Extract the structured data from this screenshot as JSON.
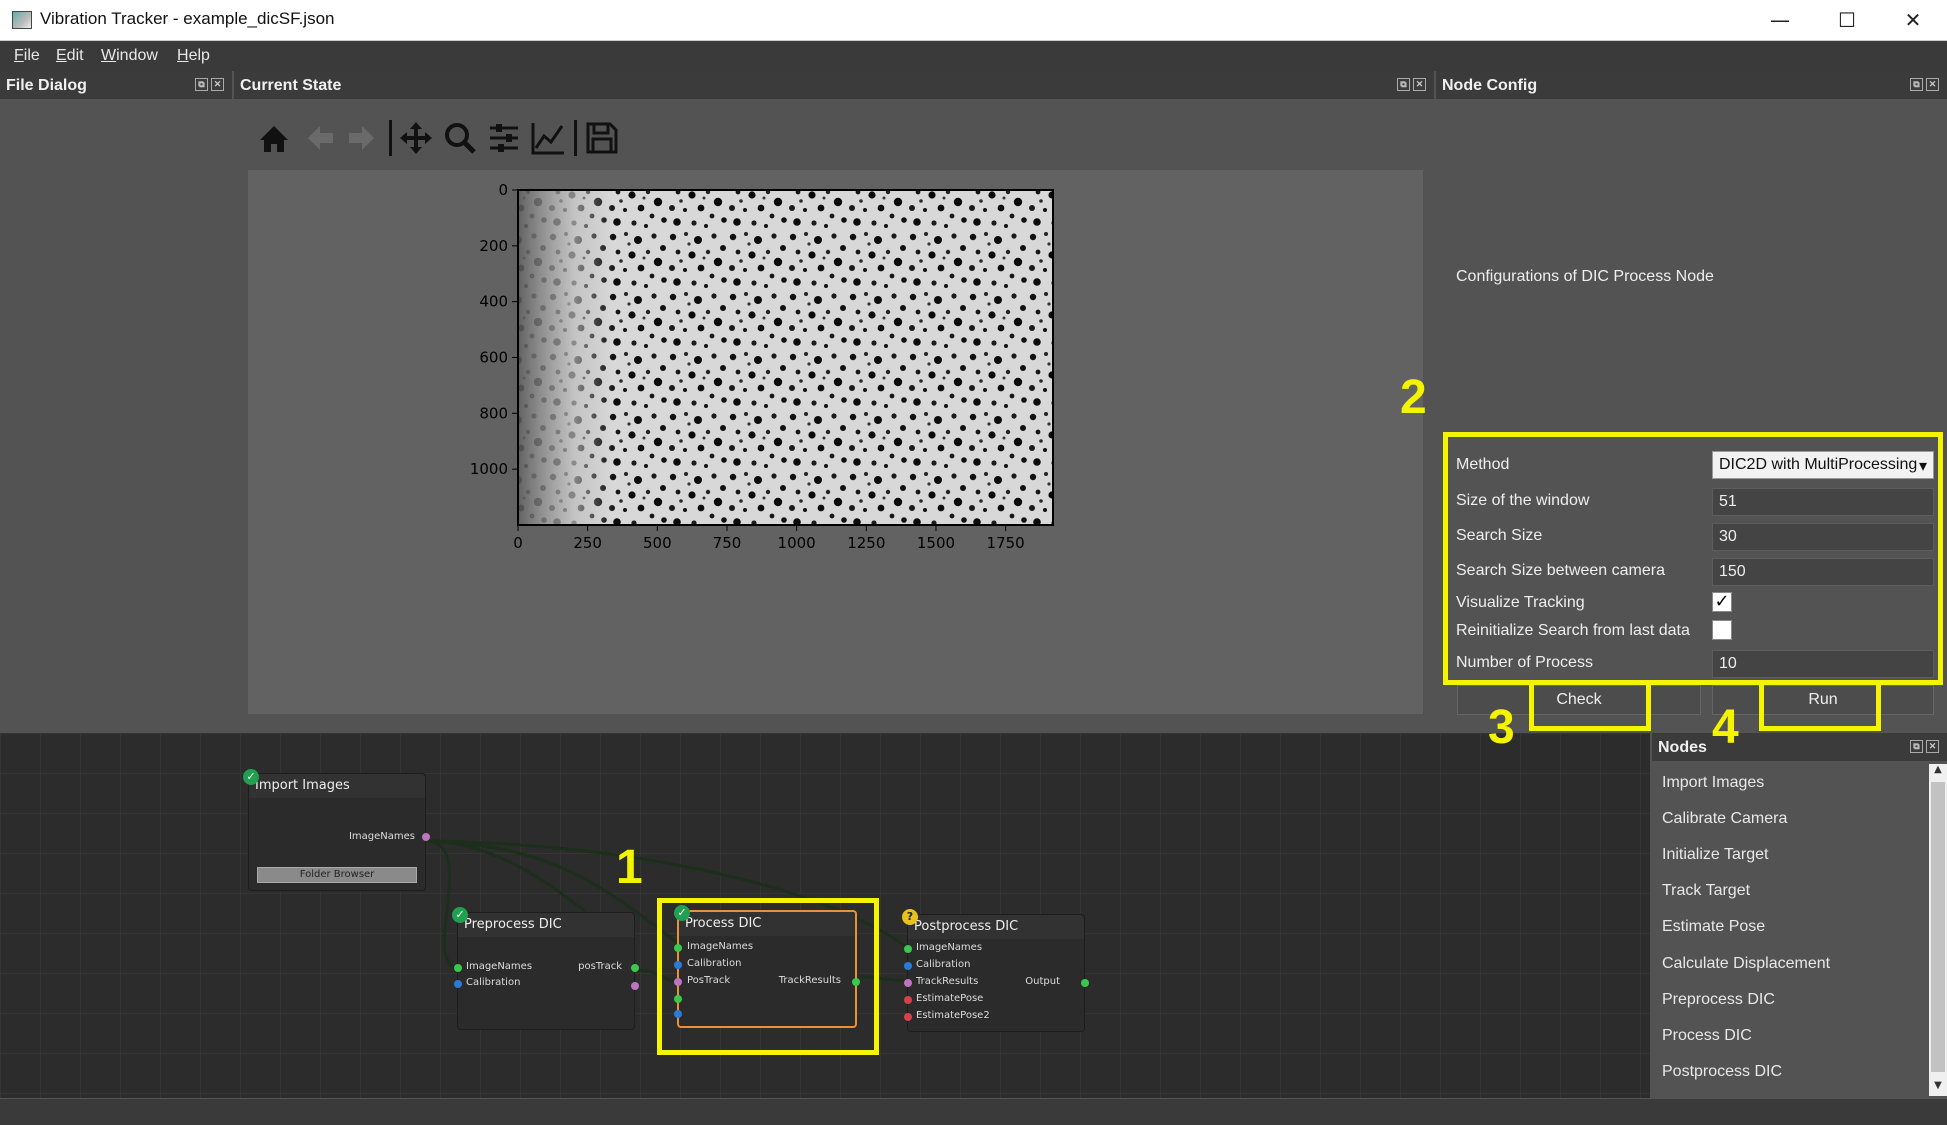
{
  "window": {
    "title": "Vibration Tracker - example_dicSF.json",
    "minimize": "—",
    "maximize": "☐",
    "close": "✕"
  },
  "menu": [
    "File",
    "Edit",
    "Window",
    "Help"
  ],
  "panels": {
    "file_dialog": "File Dialog",
    "current_state": "Current State",
    "node_config": "Node Config",
    "nodes": "Nodes"
  },
  "toolbar_icons": [
    "home-icon",
    "back-arrow-icon",
    "forward-arrow-icon",
    "pan-icon",
    "zoom-icon",
    "configure-subplots-icon",
    "edit-axis-icon",
    "save-icon"
  ],
  "chart_data": {
    "type": "image",
    "x_ticks": [
      "0",
      "250",
      "500",
      "750",
      "1000",
      "1250",
      "1500",
      "1750"
    ],
    "y_ticks": [
      "0",
      "200",
      "400",
      "600",
      "800",
      "1000"
    ],
    "xlim": [
      0,
      1920
    ],
    "ylim": [
      1200,
      0
    ]
  },
  "node_config": {
    "description": "Configurations of DIC Process Node",
    "fields": [
      {
        "label": "Method",
        "value": "DIC2D with MultiProcessing",
        "type": "select"
      },
      {
        "label": "Size of the window",
        "value": "51",
        "type": "text"
      },
      {
        "label": "Search Size",
        "value": "30",
        "type": "text"
      },
      {
        "label": "Search Size between camera",
        "value": "150",
        "type": "text"
      },
      {
        "label": "Visualize Tracking",
        "checked": true,
        "type": "checkbox"
      },
      {
        "label": "Reinitialize Search from last data",
        "checked": false,
        "type": "checkbox"
      },
      {
        "label": "Number of Process",
        "value": "10",
        "type": "text"
      }
    ],
    "check_label": "Check",
    "run_label": "Run"
  },
  "annotations": [
    "1",
    "2",
    "3",
    "4"
  ],
  "annotation_color": "#f4f400",
  "nodes_list": [
    "Import Images",
    "Calibrate Camera",
    "Initialize Target",
    "Track Target",
    "Estimate Pose",
    "Calculate Displacement",
    "Preprocess DIC",
    "Process DIC",
    "Postprocess DIC"
  ],
  "graph": {
    "import_images": {
      "title": "Import Images",
      "output": "ImageNames",
      "button": "Folder Browser"
    },
    "preprocess": {
      "title": "Preprocess DIC",
      "inputs": [
        "ImageNames",
        "Calibration"
      ],
      "output": "posTrack"
    },
    "process": {
      "title": "Process DIC",
      "inputs": [
        "ImageNames",
        "Calibration",
        "PosTrack"
      ],
      "output": "TrackResults"
    },
    "postprocess": {
      "title": "Postprocess DIC",
      "inputs": [
        "ImageNames",
        "Calibration",
        "TrackResults",
        "EstimatePose",
        "EstimatePose2"
      ],
      "output": "Output"
    },
    "status_ok": "✓",
    "status_warn": "?"
  }
}
